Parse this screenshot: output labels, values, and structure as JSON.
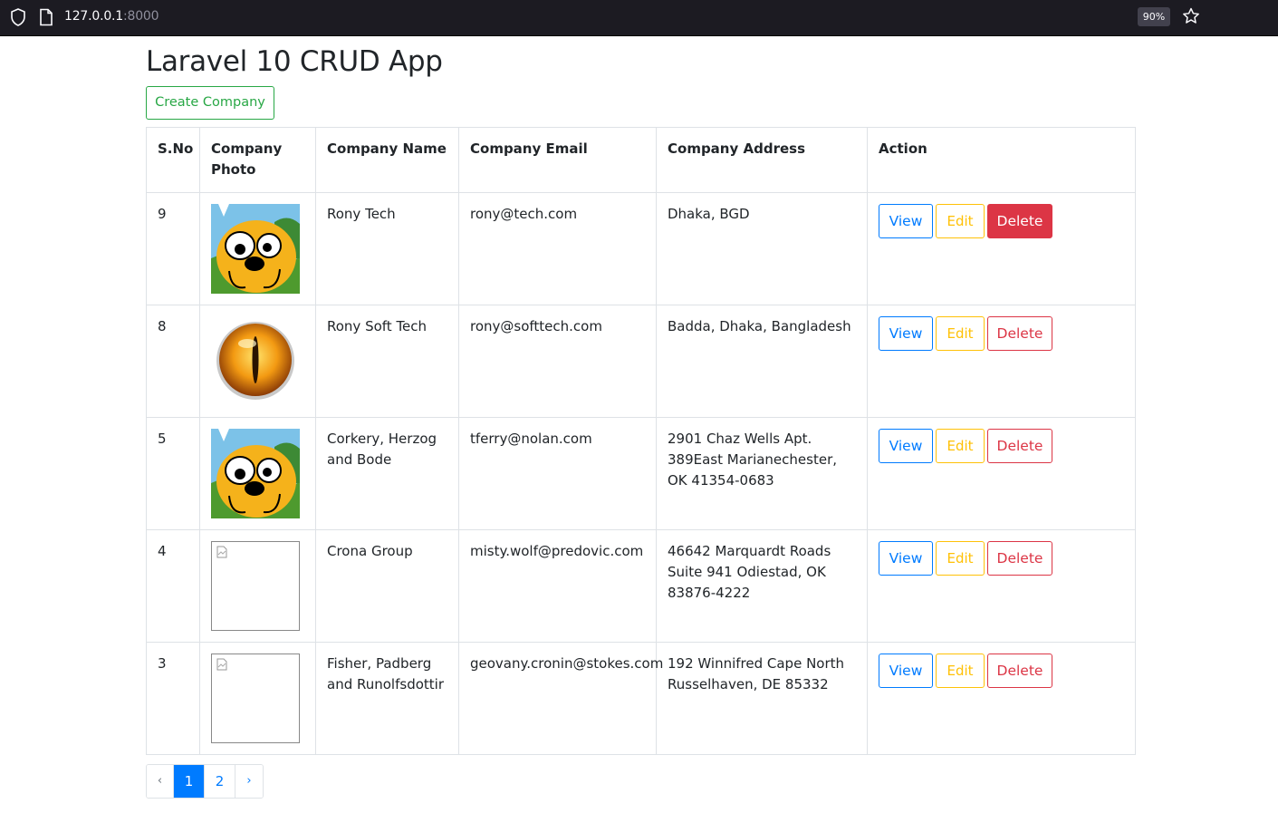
{
  "browser": {
    "url_host": "127.0.0.1",
    "url_port": ":8000",
    "zoom": "90%"
  },
  "page": {
    "title": "Laravel 10 CRUD App",
    "create_button": "Create Company"
  },
  "table": {
    "headers": {
      "sno": "S.No",
      "photo": "Company Photo",
      "name": "Company Name",
      "email": "Company Email",
      "address": "Company Address",
      "action": "Action"
    },
    "rows": [
      {
        "sno": "9",
        "photo": "cartoon-dog",
        "name": "Rony Tech",
        "email": "rony@tech.com",
        "address": "Dhaka, BGD"
      },
      {
        "sno": "8",
        "photo": "eye",
        "name": "Rony Soft Tech",
        "email": "rony@softtech.com",
        "address": "Badda, Dhaka, Bangladesh"
      },
      {
        "sno": "5",
        "photo": "cartoon-dog",
        "name": "Corkery, Herzog and Bode",
        "email": "tferry@nolan.com",
        "address": "2901 Chaz Wells Apt. 389East Marianechester, OK 41354-0683"
      },
      {
        "sno": "4",
        "photo": "broken-image",
        "name": "Crona Group",
        "email": "misty.wolf@predovic.com",
        "address": "46642 Marquardt Roads Suite 941 Odiestad, OK 83876-4222"
      },
      {
        "sno": "3",
        "photo": "broken-image",
        "name": "Fisher, Padberg and Runolfsdottir",
        "email": "geovany.cronin@stokes.com",
        "address": "192 Winnifred Cape North Russelhaven, DE 85332"
      }
    ],
    "action_labels": {
      "view": "View",
      "edit": "Edit",
      "delete": "Delete"
    }
  },
  "pagination": {
    "prev": "‹",
    "pages": [
      "1",
      "2"
    ],
    "active_page": "1",
    "next": "›"
  },
  "colors": {
    "success": "#28a745",
    "primary": "#007bff",
    "warning": "#ffc107",
    "danger": "#dc3545"
  }
}
